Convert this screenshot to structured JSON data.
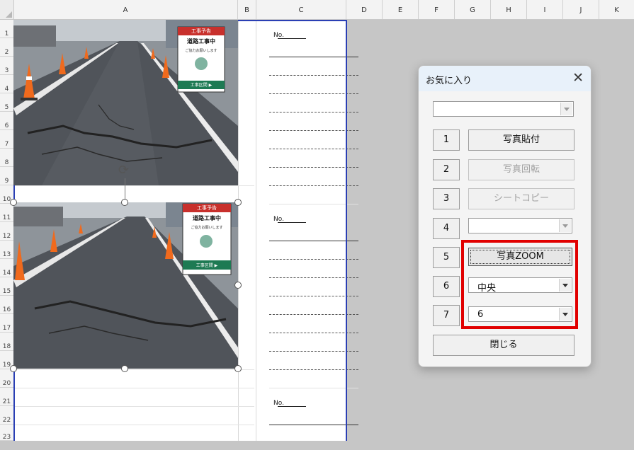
{
  "columns": [
    "A",
    "B",
    "C",
    "D",
    "E",
    "F",
    "G",
    "H",
    "I",
    "J",
    "K"
  ],
  "rows": [
    "1",
    "2",
    "3",
    "4",
    "5",
    "6",
    "7",
    "8",
    "9",
    "10",
    "11",
    "12",
    "13",
    "14",
    "15",
    "16",
    "17",
    "18",
    "19",
    "20",
    "21",
    "22",
    "23"
  ],
  "sheet": {
    "no_label": "No.",
    "photo1_sign": {
      "top": "工事予告",
      "main": "道路工事中",
      "sub": "ご協力お願いします",
      "bottom": "工事区間 ▶"
    },
    "photo2_sign": {
      "top": "工事予告",
      "main": "道路工事中",
      "sub": "ご協力お願いします",
      "bottom": "工事区間 ▶"
    }
  },
  "dialog": {
    "title": "お気に入り",
    "close": "✕",
    "top_combo_value": "",
    "buttons": [
      {
        "num": "1",
        "label": "写真貼付",
        "enabled": true
      },
      {
        "num": "2",
        "label": "写真回転",
        "enabled": false
      },
      {
        "num": "3",
        "label": "シートコピー",
        "enabled": false
      },
      {
        "num": "4",
        "label": "",
        "enabled": false
      },
      {
        "num": "5",
        "label": "写真ZOOM",
        "enabled": true
      },
      {
        "num": "6",
        "label": "中央",
        "enabled": true
      },
      {
        "num": "7",
        "label": "6",
        "enabled": true
      }
    ],
    "close_button": "閉じる"
  },
  "colors": {
    "highlight": "#e10000",
    "print_border": "#2a3fb4",
    "title_bar": "#e8f1fa"
  }
}
